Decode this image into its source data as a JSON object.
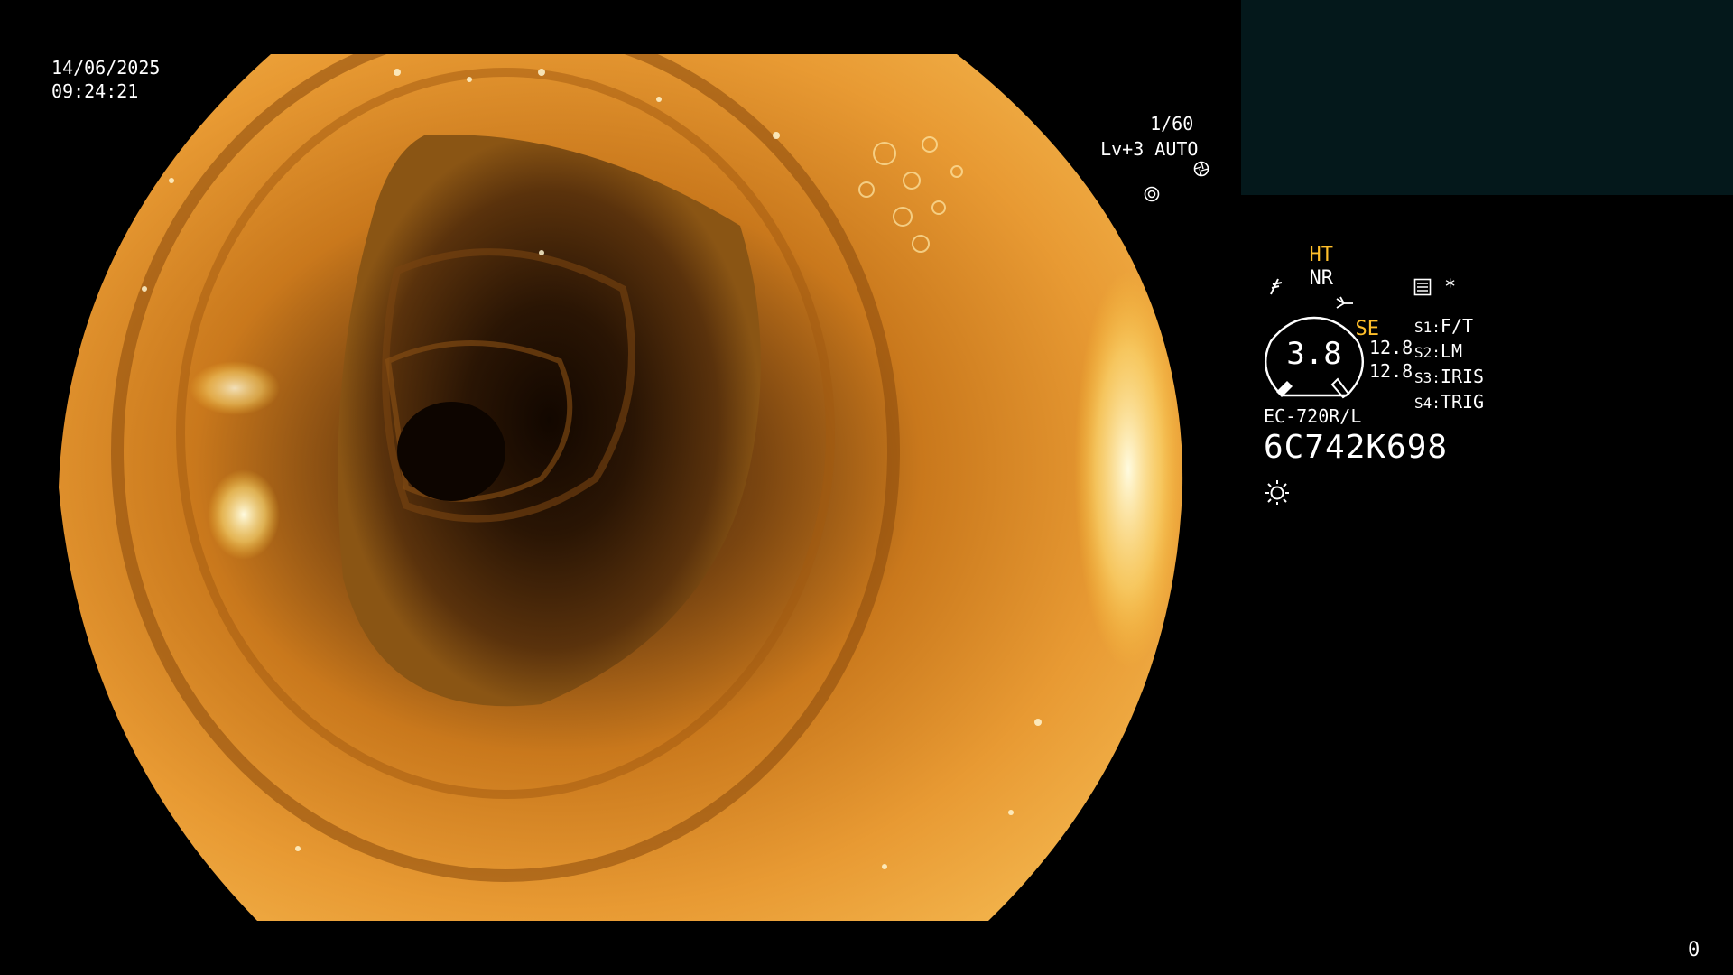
{
  "overlay": {
    "date": "14/06/2025",
    "time": "09:24:21",
    "shutter": "1/60",
    "level_mode": "Lv+3 AUTO"
  },
  "panel": {
    "ht": "HT",
    "nr": "NR",
    "se": "SE",
    "gauge_value": "3.8",
    "sub_values": [
      "12.8",
      "12.8"
    ],
    "switches": [
      {
        "key": "S1:",
        "label": "F/T"
      },
      {
        "key": "S2:",
        "label": "LM"
      },
      {
        "key": "S3:",
        "label": "IRIS"
      },
      {
        "key": "S4:",
        "label": "TRIG"
      }
    ],
    "scope_model": "EC-720R/L",
    "serial": "6C742K698",
    "asterisk": "*"
  },
  "footer": {
    "counter": "0"
  },
  "icons": {
    "shutter": "aperture-icon",
    "auto": "ring-icon",
    "scissors": "scissors-icon",
    "flag": "flag-icon",
    "memo": "memo-icon",
    "light": "sun-icon"
  },
  "colors": {
    "accent_yellow": "#ffbf2a",
    "thumb_bg": "#04181b",
    "background": "#000000"
  }
}
